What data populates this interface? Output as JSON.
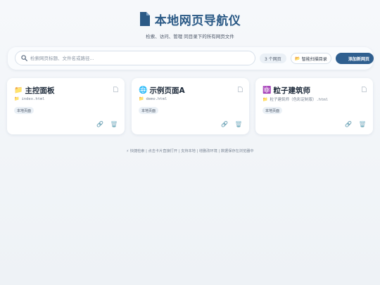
{
  "header": {
    "title": "本地网页导航仪",
    "subtitle": "检索、访问、管理 同目录下的所有网页文件"
  },
  "toolbar": {
    "search_placeholder": "检索网页标题、文件名或路径...",
    "count_label": "3 个网页",
    "scan_label": "智能扫描目录",
    "add_label": "添加新网页"
  },
  "cards": [
    {
      "emoji": "📁",
      "name": "主控面板",
      "file": "index.html",
      "tag": "本地页面"
    },
    {
      "emoji": "🌐",
      "name": "示例页面A",
      "file": "demo.html",
      "tag": "本地页面"
    },
    {
      "emoji": "⚛️",
      "name": "粒子建筑师",
      "file": "粒子建筑师（色彩定制版）.html",
      "tag": "本地页面"
    }
  ],
  "footer": {
    "text": "⚡ 快捷检索 | 点击卡片直接打开 | 支持本地 | 增删改环境 | 数据保存在浏览器中"
  },
  "colors": {
    "accent": "#2f5f8f",
    "title": "#2b5a86",
    "background": "#f2f5f9"
  }
}
